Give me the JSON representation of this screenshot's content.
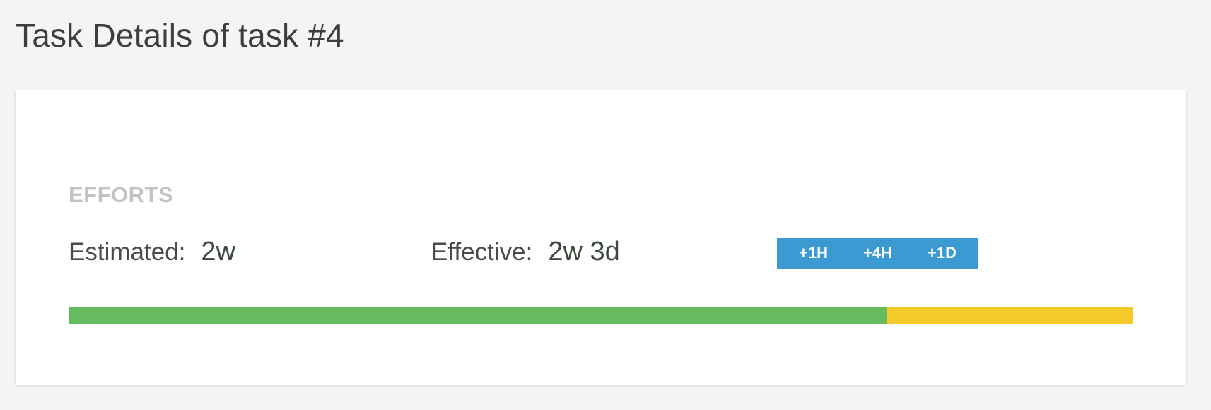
{
  "page": {
    "title": "Task Details of task #4"
  },
  "efforts": {
    "section_label": "EFFORTS",
    "estimated_label": "Estimated:",
    "estimated_value": "2w",
    "effective_label": "Effective:",
    "effective_value": "2w 3d",
    "buttons": [
      "+1H",
      "+4H",
      "+1D"
    ],
    "progress": {
      "estimated_fraction": 0.769,
      "overrun_fraction": 0.231
    }
  },
  "colors": {
    "button_bg": "#3a9ad1",
    "progress_done": "#66bb5f",
    "progress_overrun": "#f4ca2b"
  }
}
